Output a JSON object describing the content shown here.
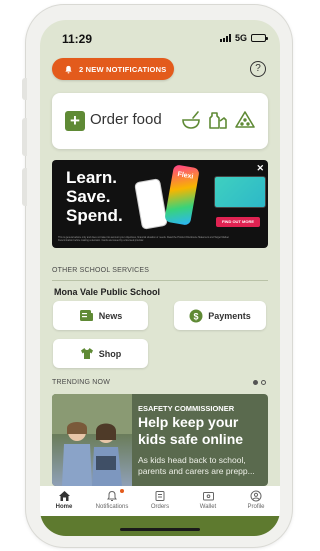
{
  "status_bar": {
    "time": "11:29",
    "network": "5G",
    "signal_bars": 4,
    "battery_level": 0.7
  },
  "notifications": {
    "label": "2 NEW NOTIFICATIONS",
    "count": 2
  },
  "help": {
    "label": "?"
  },
  "order_food": {
    "label": "Order food",
    "icons": [
      "bowl-icon",
      "bottle-icon",
      "watermelon-icon"
    ]
  },
  "ad_banner": {
    "headline_1": "Learn.",
    "headline_2": "Save.",
    "headline_3": "Spend.",
    "logo_text": "Flexi",
    "cta": "FIND OUT MORE",
    "close_label": "✕",
    "fine_print": "This is general advice only and does not take into account your objectives, financial situation or needs. Read the Product Disclosure Statement and Target Market Determination before making a decision. Cards are issued by a licensed provider."
  },
  "other_services": {
    "heading": "OTHER SCHOOL SERVICES",
    "school": "Mona Vale Public School",
    "buttons": [
      {
        "label": "News",
        "icon": "newspaper-icon"
      },
      {
        "label": "Payments",
        "icon": "dollar-icon"
      },
      {
        "label": "Shop",
        "icon": "tshirt-icon"
      }
    ]
  },
  "trending": {
    "heading": "TRENDING NOW",
    "pages": 2,
    "active_page": 1,
    "card": {
      "eyebrow": "ESAFETY COMMISSIONER",
      "title": "Help keep your kids safe online",
      "body": "As kids head back to school, parents and carers are prepp..."
    }
  },
  "tabs": [
    {
      "label": "Home",
      "icon": "home-icon",
      "active": true
    },
    {
      "label": "Notifications",
      "icon": "bell-icon",
      "active": false,
      "badge": true
    },
    {
      "label": "Orders",
      "icon": "orders-icon",
      "active": false
    },
    {
      "label": "Wallet",
      "icon": "wallet-icon",
      "active": false
    },
    {
      "label": "Profile",
      "icon": "profile-icon",
      "active": false
    }
  ],
  "colors": {
    "accent": "#e35b1c",
    "brand_green": "#5f8a35",
    "screen_bg": "#dfe5d2",
    "card_dark": "#5a6a4e"
  }
}
